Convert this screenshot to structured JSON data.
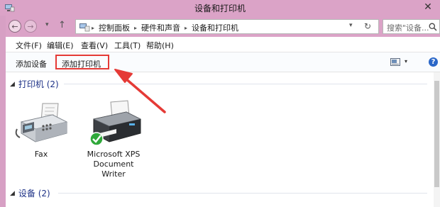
{
  "window": {
    "title": "设备和打印机",
    "close_glyph": "✕"
  },
  "address": {
    "back_glyph": "←",
    "forward_glyph": "→",
    "history_glyph": "▾",
    "up_glyph": "↑",
    "crumb_sep_glyph": "▸",
    "crumbs": [
      "控制面板",
      "硬件和声音",
      "设备和打印机"
    ],
    "dropdown_glyph": "▾",
    "refresh_glyph": "↻",
    "search_placeholder": "搜索\"设备...",
    "icons": {
      "location": "devices-printers-icon",
      "search": "search-icon"
    }
  },
  "menu": {
    "items": [
      "文件(F)",
      "编辑(E)",
      "查看(V)",
      "工具(T)",
      "帮助(H)"
    ]
  },
  "commandbar": {
    "add_device": "添加设备",
    "add_printer": "添加打印机",
    "view_dropdown_glyph": "▾",
    "help_glyph": "?"
  },
  "groups": {
    "caret_glyph": "◢",
    "printers": {
      "title": "打印机 (2)",
      "items": [
        {
          "label": "Fax",
          "icon": "fax-printer-icon"
        },
        {
          "label": "Microsoft XPS Document Writer",
          "label_lines": [
            "Microsoft XPS",
            "Document",
            "Writer"
          ],
          "icon": "xps-printer-icon",
          "is_default": true
        }
      ]
    },
    "devices": {
      "title": "设备 (2)"
    }
  },
  "colors": {
    "titlebar": "#dba3c7",
    "group_header": "#1e3287",
    "annotation": "#e53a36",
    "help": "#2a67c8",
    "default_check": "#2fa83a"
  }
}
